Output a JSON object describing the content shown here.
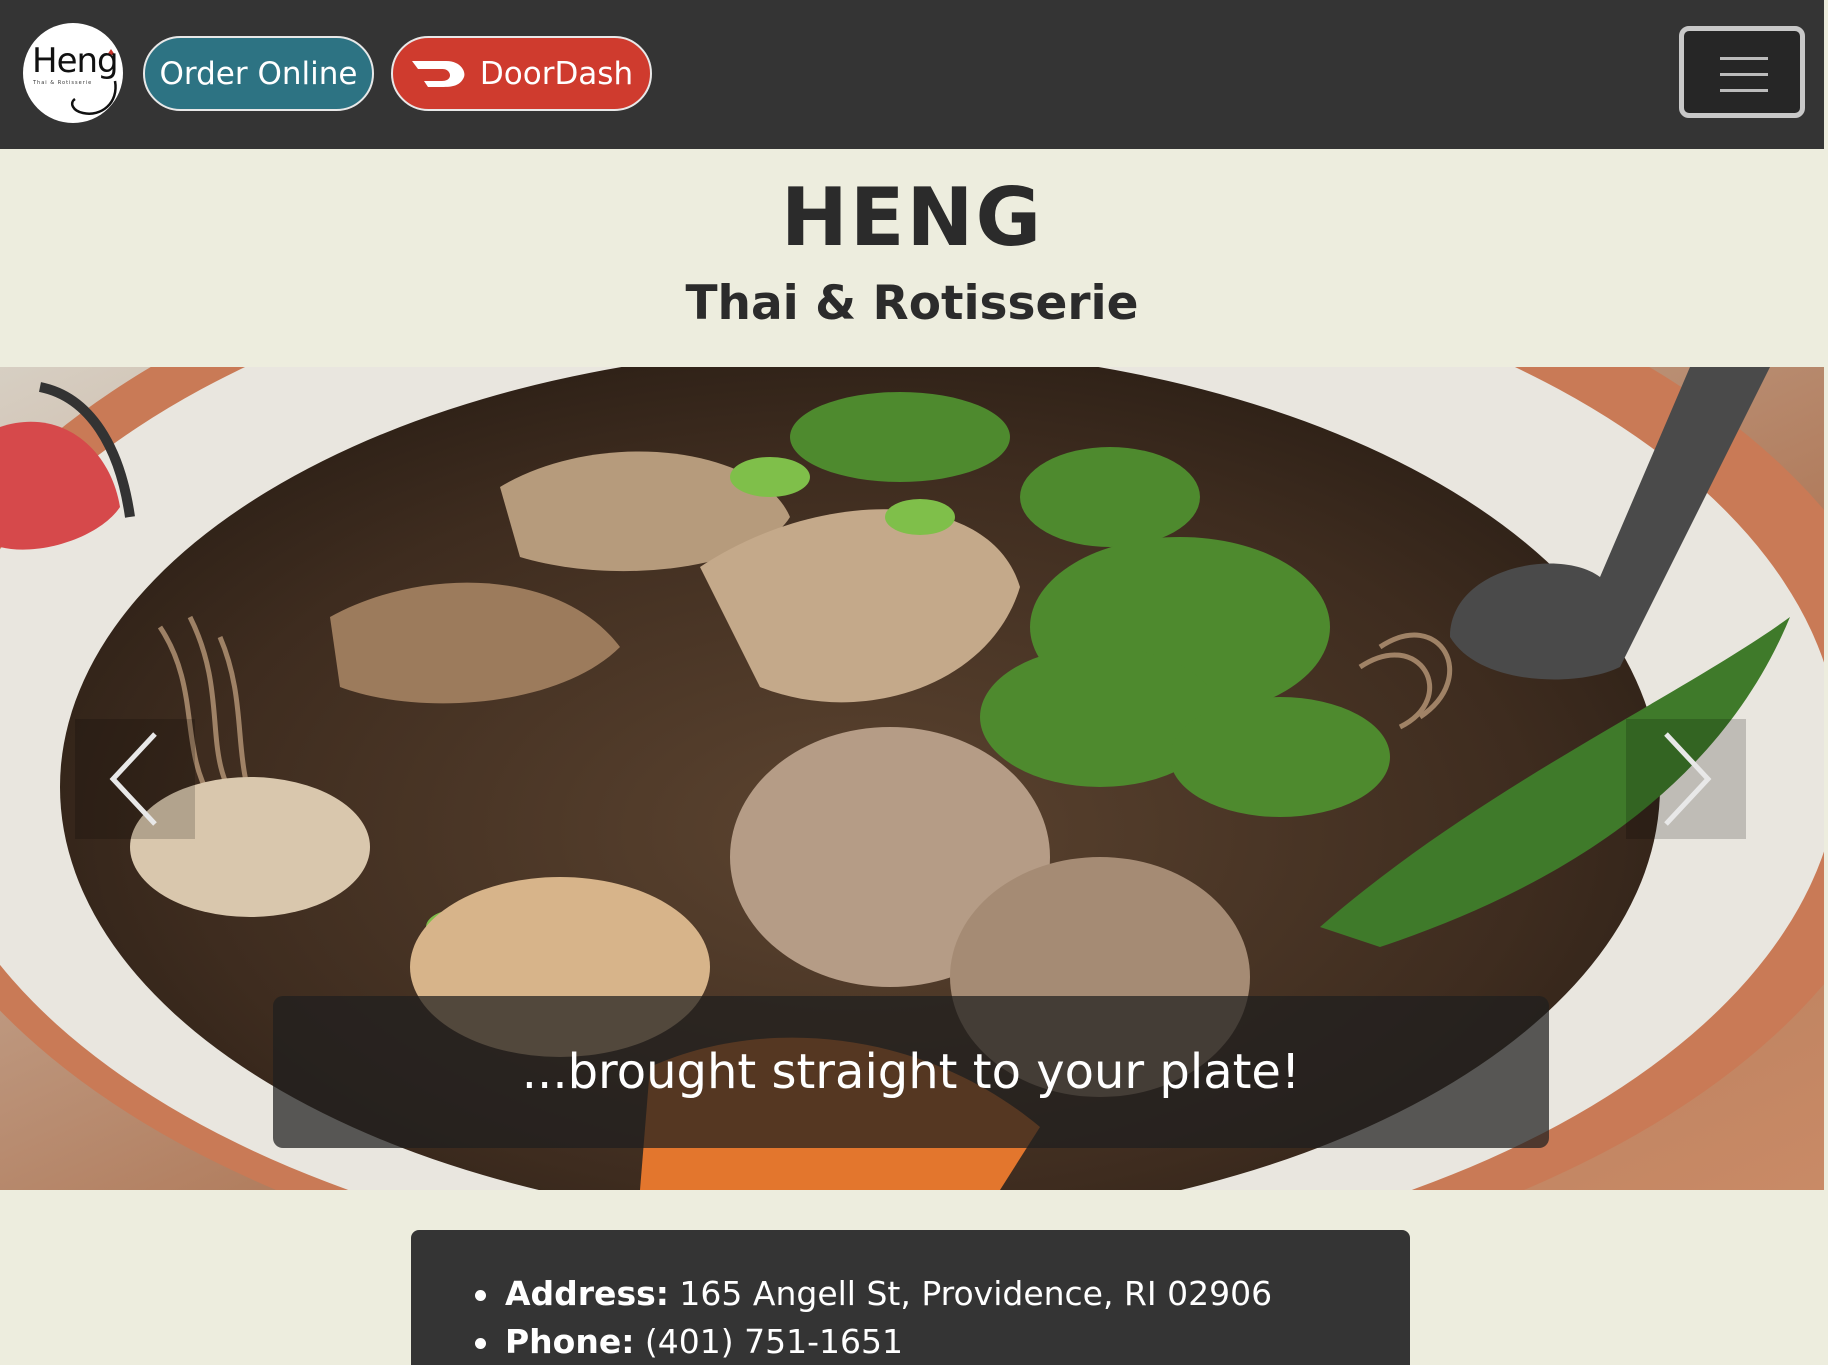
{
  "navbar": {
    "logo": {
      "text": "Heng",
      "subtext": "Thai & Rotisserie",
      "icon": "rooster-icon"
    },
    "order_online_label": "Order Online",
    "doordash_label": "DoorDash",
    "doordash_icon": "doordash-logo-icon",
    "menu_icon": "hamburger-menu-icon",
    "colors": {
      "background": "#343434",
      "order_button": "#2d7383",
      "doordash_button": "#cf3b2e"
    }
  },
  "header": {
    "title": "HENG",
    "subtitle": "Thai & Rotisserie"
  },
  "carousel": {
    "image": "boat-noodle-soup-photo",
    "caption": "...brought straight to your plate!",
    "prev_icon": "chevron-left-icon",
    "next_icon": "chevron-right-icon"
  },
  "info": {
    "items": [
      {
        "label": "Address:",
        "value": " 165 Angell St, Providence, RI 02906"
      },
      {
        "label": "Phone:",
        "value": " (401) 751-1651"
      }
    ]
  }
}
